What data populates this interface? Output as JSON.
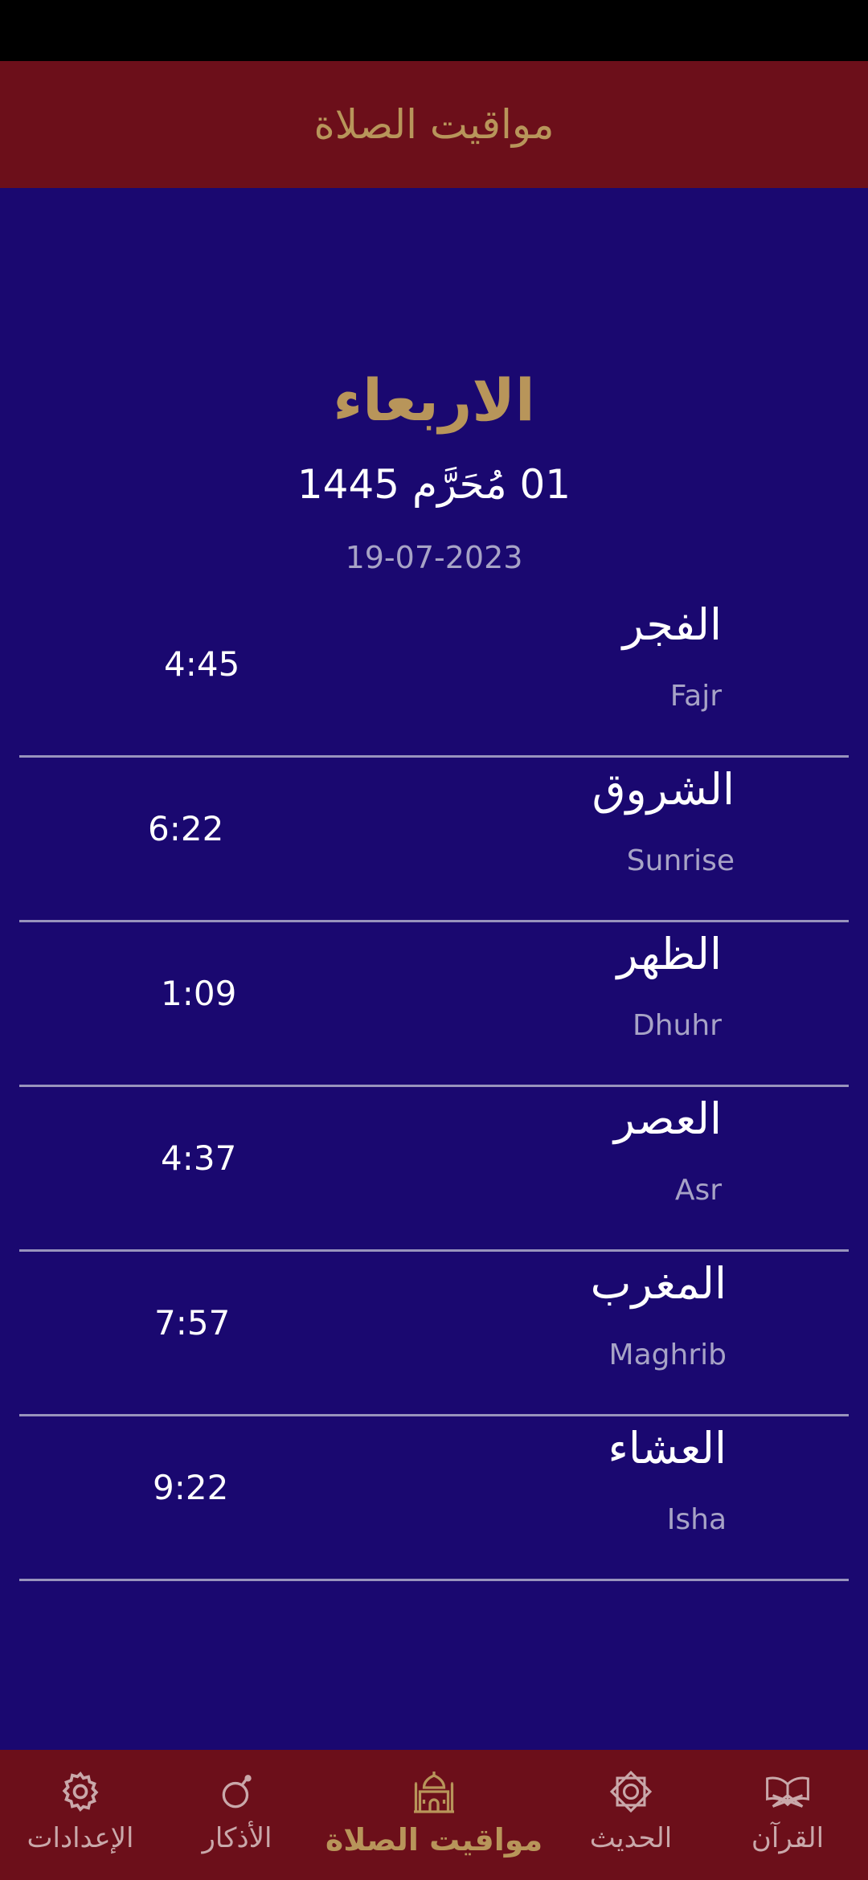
{
  "header": {
    "title": "مواقيت الصلاة"
  },
  "date": {
    "day_name": "الاربعاء",
    "hijri": "01 مُحَرَّم 1445",
    "gregorian": "19-07-2023"
  },
  "prayers": [
    {
      "name_ar": "الفجر",
      "name_en": "Fajr",
      "time": "4:45"
    },
    {
      "name_ar": "الشروق",
      "name_en": "Sunrise",
      "time": "6:22"
    },
    {
      "name_ar": "الظهر",
      "name_en": "Dhuhr",
      "time": "1:09"
    },
    {
      "name_ar": "العصر",
      "name_en": "Asr",
      "time": "4:37"
    },
    {
      "name_ar": "المغرب",
      "name_en": "Maghrib",
      "time": "7:57"
    },
    {
      "name_ar": "العشاء",
      "name_en": "Isha",
      "time": "9:22"
    }
  ],
  "nav": {
    "items": [
      {
        "label": "الإعدادات",
        "icon": "gear-icon"
      },
      {
        "label": "الأذكار",
        "icon": "prayer-beads-icon"
      },
      {
        "label": "مواقيت الصلاة",
        "icon": "mosque-icon",
        "active": true
      },
      {
        "label": "الحديث",
        "icon": "star-octagon-icon"
      },
      {
        "label": "القرآن",
        "icon": "quran-book-icon"
      }
    ]
  },
  "colors": {
    "background": "#1a0870",
    "bar": "#6c0f1a",
    "accent_gold": "#b8955a",
    "divider": "#9893bd"
  }
}
